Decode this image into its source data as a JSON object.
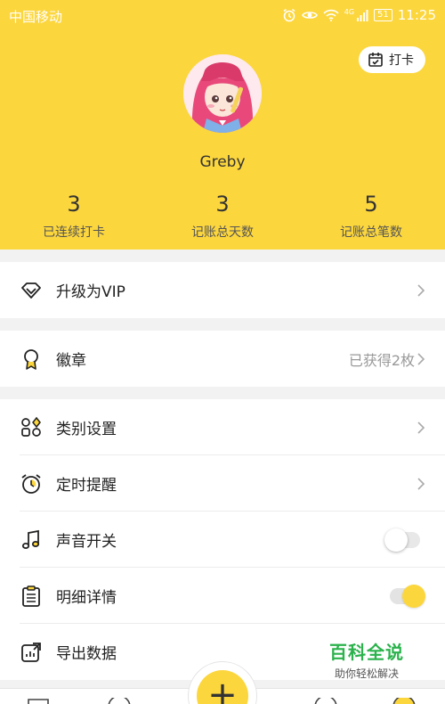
{
  "status_bar": {
    "carrier": "中国移动",
    "network": "4G",
    "battery": "51",
    "time": "11:25"
  },
  "header": {
    "checkin_label": "打卡",
    "username": "Greby",
    "stats": [
      {
        "value": "3",
        "label": "已连续打卡"
      },
      {
        "value": "3",
        "label": "记账总天数"
      },
      {
        "value": "5",
        "label": "记账总笔数"
      }
    ]
  },
  "menu": {
    "vip": {
      "label": "升级为VIP"
    },
    "badge": {
      "label": "徽章",
      "value": "已获得2枚"
    },
    "category": {
      "label": "类别设置"
    },
    "reminder": {
      "label": "定时提醒"
    },
    "sound": {
      "label": "声音开关",
      "enabled": false
    },
    "detail": {
      "label": "明细详情",
      "enabled": true
    },
    "export": {
      "label": "导出数据"
    }
  },
  "tabbar": {
    "add_symbol": "+"
  },
  "watermark": {
    "title": "百科全说",
    "subtitle": "助你轻松解决"
  },
  "colors": {
    "accent": "#fcd63d",
    "background": "#f2f2f2",
    "watermark": "#2bb24c"
  }
}
